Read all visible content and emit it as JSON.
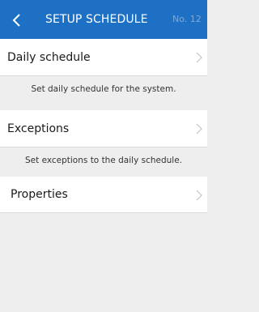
{
  "header": {
    "title": "SETUP SCHEDULE",
    "number": "No. 12",
    "back_icon": "chevron-left-icon",
    "background": "#1d70c4"
  },
  "items": [
    {
      "label": "Daily schedule",
      "description": "Set daily schedule for the system.",
      "icon": "chevron-right-icon"
    },
    {
      "label": "Exceptions",
      "description": "Set exceptions to the daily schedule.",
      "icon": "chevron-right-icon"
    },
    {
      "label": "Properties",
      "icon": "chevron-right-icon"
    }
  ]
}
